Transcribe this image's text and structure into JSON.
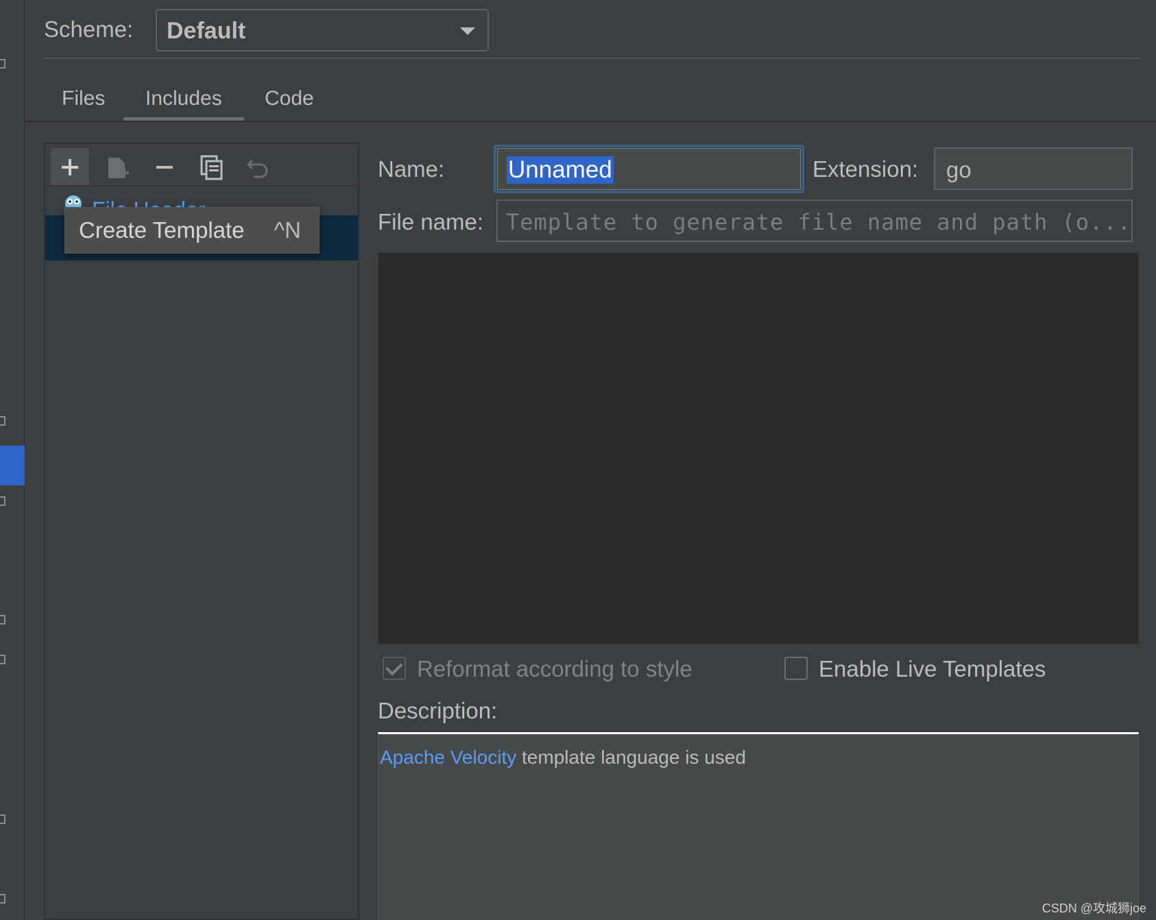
{
  "scheme": {
    "label": "Scheme:",
    "value": "Default"
  },
  "tabs": [
    {
      "label": "Files",
      "selected": false
    },
    {
      "label": "Includes",
      "selected": true
    },
    {
      "label": "Code",
      "selected": false
    }
  ],
  "toolbar": {
    "icons": [
      "plus-icon",
      "add-child-file-icon",
      "minus-icon",
      "copy-icon",
      "undo-icon"
    ]
  },
  "tree": {
    "items": [
      {
        "label": "File Header",
        "icon": "gopher-icon"
      }
    ]
  },
  "tooltip": {
    "text": "Create Template",
    "shortcut": "^N"
  },
  "form": {
    "name_label": "Name:",
    "name_value": "Unnamed",
    "extension_label": "Extension:",
    "extension_value": "go",
    "file_name_label": "File name:",
    "file_name_placeholder": "Template to generate file name and path (o..."
  },
  "options": {
    "reformat_label": "Reformat according to style",
    "reformat_checked": true,
    "reformat_disabled": true,
    "live_templates_label": "Enable Live Templates",
    "live_templates_checked": false
  },
  "description": {
    "label": "Description:",
    "link_text": "Apache Velocity",
    "text": " template language is used"
  },
  "watermark": "CSDN @攻城狮joe",
  "colors": {
    "accent": "#2f65ca",
    "link": "#589df6",
    "background": "#3c3f41",
    "editor": "#2b2b2b"
  }
}
